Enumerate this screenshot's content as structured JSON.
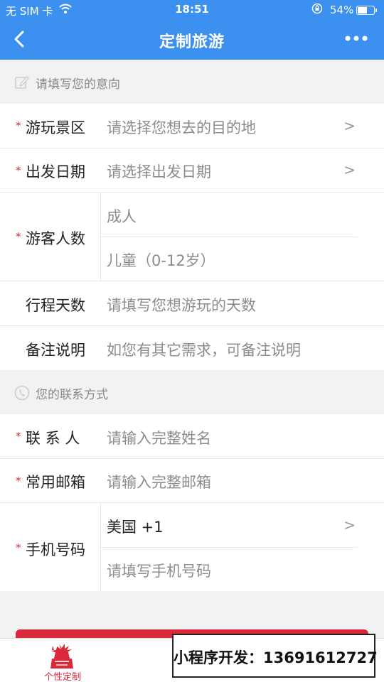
{
  "status": {
    "carrier": "无 SIM 卡",
    "time": "18:51",
    "battery": "54%",
    "battery_level": 0.54
  },
  "nav": {
    "title": "定制旅游"
  },
  "section1": {
    "title": "请填写您的意向"
  },
  "form1": {
    "scenic": {
      "label": "游玩景区",
      "placeholder": "请选择您想去的目的地",
      "chevron": ">"
    },
    "date": {
      "label": "出发日期",
      "placeholder": "请选择出发日期",
      "chevron": ">"
    },
    "people": {
      "label": "游客人数",
      "adult": "成人",
      "child": "儿童（0-12岁）"
    },
    "days": {
      "label": "行程天数",
      "placeholder": "请填写您想游玩的天数"
    },
    "notes": {
      "label": "备注说明",
      "placeholder": "如您有其它需求，可备注说明"
    }
  },
  "section2": {
    "title": "您的联系方式"
  },
  "form2": {
    "contact": {
      "label": "联 系 人",
      "placeholder": "请输入完整姓名"
    },
    "email": {
      "label": "常用邮箱",
      "placeholder": "请输入完整邮箱"
    },
    "phone": {
      "label": "手机号码",
      "country": "美国 +1",
      "chevron": ">",
      "placeholder": "请填写手机号码"
    }
  },
  "required_mark": "*",
  "tabbar": {
    "tab1_label": "个性定制"
  },
  "promo": {
    "text": "小程序开发：13691612727"
  },
  "colors": {
    "nav": "#3b90f0",
    "accent": "#d9293b",
    "background": "#f2f2f4"
  }
}
